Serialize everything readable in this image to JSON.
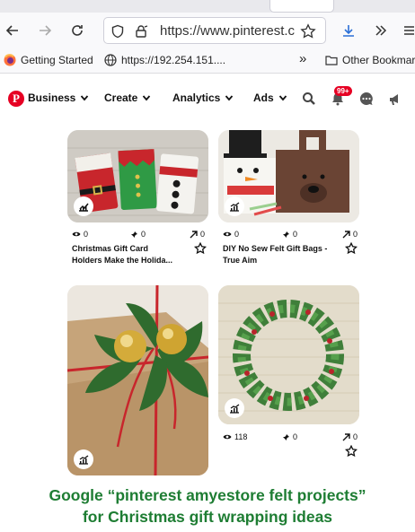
{
  "browser": {
    "url": "https://www.pinterest.c",
    "bookmarks": [
      {
        "label": "Getting Started",
        "icon": "firefox-icon"
      },
      {
        "label": "https://192.254.151....",
        "icon": "globe-icon"
      },
      {
        "label": "Other Bookmar",
        "icon": "folder-icon"
      }
    ],
    "overflow_label": "»"
  },
  "pinterest_nav": {
    "logo": "P",
    "menus": [
      {
        "label": "Business"
      },
      {
        "label": "Create"
      },
      {
        "label": "Analytics"
      },
      {
        "label": "Ads"
      }
    ],
    "notifications_badge": "99+"
  },
  "pins": [
    {
      "title_line1": "Christmas Gift Card",
      "title_line2": "Holders Make the Holida...",
      "impressions": "0",
      "saves": "0",
      "clicks": "0"
    },
    {
      "title_line1": "DIY No Sew Felt Gift Bags -",
      "title_line2": "True Aim",
      "impressions": "0",
      "saves": "0",
      "clicks": "0"
    },
    {
      "title_line1": "",
      "title_line2": "",
      "impressions": "",
      "saves": "",
      "clicks": ""
    },
    {
      "title_line1": "",
      "title_line2": "",
      "impressions": "118",
      "saves": "0",
      "clicks": "0"
    }
  ],
  "caption": {
    "line1": "Google “pinterest amyestore felt projects”",
    "line2": "for Christmas gift wrapping ideas"
  },
  "colors": {
    "pinterest_red": "#e60023",
    "caption_green": "#1e7d33",
    "felt_green": "#2f6b2e",
    "felt_red": "#c8262c"
  }
}
